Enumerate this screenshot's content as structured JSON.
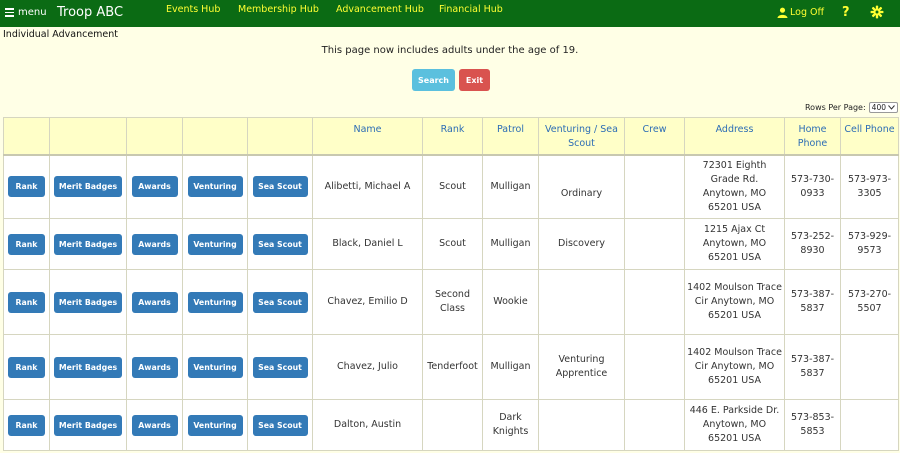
{
  "topbar": {
    "menu_label": "menu",
    "brand": "Troop ABC",
    "nav": [
      "Events Hub",
      "Membership Hub",
      "Advancement Hub",
      "Financial Hub"
    ],
    "logoff_label": "Log Off",
    "help_label": "?",
    "bg_color": "#0b6b14",
    "link_color": "#ffff33"
  },
  "page": {
    "title": "Individual Advancement",
    "notice": "This page now includes adults under the age of 19.",
    "search_label": "Search",
    "exit_label": "Exit",
    "rows_per_page_label": "Rows Per Page:",
    "rows_per_page_value": "400"
  },
  "table": {
    "headers": [
      "",
      "",
      "",
      "",
      "",
      "Name",
      "Rank",
      "Patrol",
      "Venturing / Sea Scout",
      "Crew",
      "Address",
      "Home Phone",
      "Cell Phone"
    ],
    "row_buttons": [
      "Rank",
      "Merit Badges",
      "Awards",
      "Venturing",
      "Sea Scout"
    ],
    "rows": [
      {
        "name": "Alibetti, Michael A",
        "rank": "Scout",
        "patrol": "Mulligan",
        "venturing": "Ordinary",
        "crew": "",
        "address": "72301 Eighth Grade Rd. Anytown, MO 65201 USA",
        "home": "573-730-0933",
        "cell": "573-973-3305"
      },
      {
        "name": "Black, Daniel L",
        "rank": "Scout",
        "patrol": "Mulligan",
        "venturing": "Discovery",
        "crew": "",
        "address": "1215 Ajax Ct Anytown, MO 65201 USA",
        "home": "573-252-8930",
        "cell": "573-929-9573"
      },
      {
        "name": "Chavez, Emilio D",
        "rank": "Second Class",
        "patrol": "Wookie",
        "venturing": "",
        "crew": "",
        "address": "1402 Moulson Trace Cir Anytown, MO 65201 USA",
        "home": "573-387-5837",
        "cell": "573-270-5507"
      },
      {
        "name": "Chavez, Julio",
        "rank": "Tenderfoot",
        "patrol": "Mulligan",
        "venturing": "Venturing Apprentice",
        "crew": "",
        "address": "1402 Moulson Trace Cir Anytown, MO 65201 USA",
        "home": "573-387-5837",
        "cell": ""
      },
      {
        "name": "Dalton, Austin",
        "rank": "",
        "patrol": "Dark Knights",
        "venturing": "",
        "crew": "",
        "address": "446 E. Parkside Dr. Anytown, MO 65201 USA",
        "home": "573-853-5853",
        "cell": ""
      }
    ]
  }
}
